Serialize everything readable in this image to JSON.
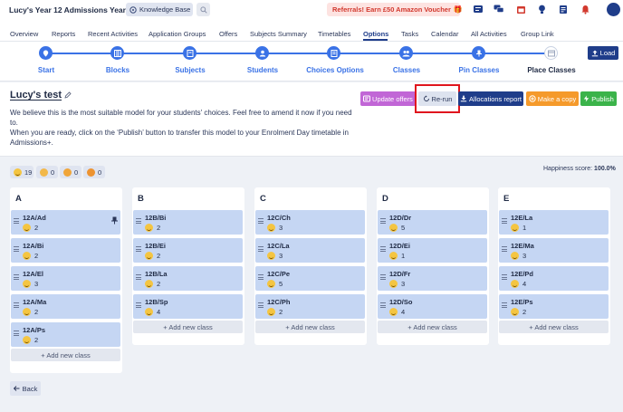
{
  "topbar": {
    "school_title": "Lucy's Year 12 Admissions Year ...",
    "knowledge_base": "Knowledge Base",
    "referral": "Referrals! Earn £50 Amazon Voucher",
    "icons": [
      "search-icon",
      "gift-icon",
      "toggle-icon",
      "chat-icon",
      "calendar-icon",
      "bulb-icon",
      "doc-icon",
      "bell-icon",
      "avatar"
    ]
  },
  "nav": {
    "items": [
      "Overview",
      "Reports",
      "Recent Activities",
      "Application Groups",
      "Offers",
      "Subjects Summary",
      "Timetables",
      "Options",
      "Tasks",
      "Calendar",
      "All Activities",
      "Group Link"
    ],
    "active": "Options"
  },
  "stepper": {
    "steps": [
      "Start",
      "Blocks",
      "Subjects",
      "Students",
      "Choices Options",
      "Classes",
      "Pin Classes",
      "Place Classes"
    ],
    "load_label": "Load"
  },
  "header": {
    "title": "Lucy's test",
    "desc_line1": "We believe this is the most suitable model for your students' choices. Feel free to amend it now if you need to.",
    "desc_line2": "When you are ready, click on the ‘Publish’ button to transfer this model to your Enrolment Day timetable in Admissions+.",
    "buttons": {
      "update_offers": "Update offers",
      "rerun": "Re-run",
      "allocations": "Allocations report",
      "copy": "Make a copy",
      "publish": "Publish"
    }
  },
  "summary": {
    "counts": [
      "19",
      "0",
      "0",
      "0"
    ],
    "happiness_label": "Happiness score:",
    "happiness_value": "100.0%"
  },
  "columns": [
    {
      "title": "A",
      "classes": [
        {
          "name": "12A/Ad",
          "count": "2",
          "pinned": true
        },
        {
          "name": "12A/Bi",
          "count": "2"
        },
        {
          "name": "12A/El",
          "count": "3"
        },
        {
          "name": "12A/Ma",
          "count": "2"
        },
        {
          "name": "12A/Ps",
          "count": "2"
        }
      ]
    },
    {
      "title": "B",
      "classes": [
        {
          "name": "12B/Bi",
          "count": "2"
        },
        {
          "name": "12B/Ei",
          "count": "2"
        },
        {
          "name": "12B/La",
          "count": "2"
        },
        {
          "name": "12B/Sp",
          "count": "4"
        }
      ]
    },
    {
      "title": "C",
      "classes": [
        {
          "name": "12C/Ch",
          "count": "3"
        },
        {
          "name": "12C/La",
          "count": "3"
        },
        {
          "name": "12C/Pe",
          "count": "5"
        },
        {
          "name": "12C/Ph",
          "count": "2"
        }
      ]
    },
    {
      "title": "D",
      "classes": [
        {
          "name": "12D/Dr",
          "count": "5"
        },
        {
          "name": "12D/Ei",
          "count": "1"
        },
        {
          "name": "12D/Fr",
          "count": "3"
        },
        {
          "name": "12D/So",
          "count": "4"
        }
      ]
    },
    {
      "title": "E",
      "classes": [
        {
          "name": "12E/La",
          "count": "1"
        },
        {
          "name": "12E/Ma",
          "count": "3"
        },
        {
          "name": "12E/Pd",
          "count": "4"
        },
        {
          "name": "12E/Ps",
          "count": "2"
        }
      ]
    }
  ],
  "add_class_label": "+ Add new class",
  "back_label": "Back"
}
